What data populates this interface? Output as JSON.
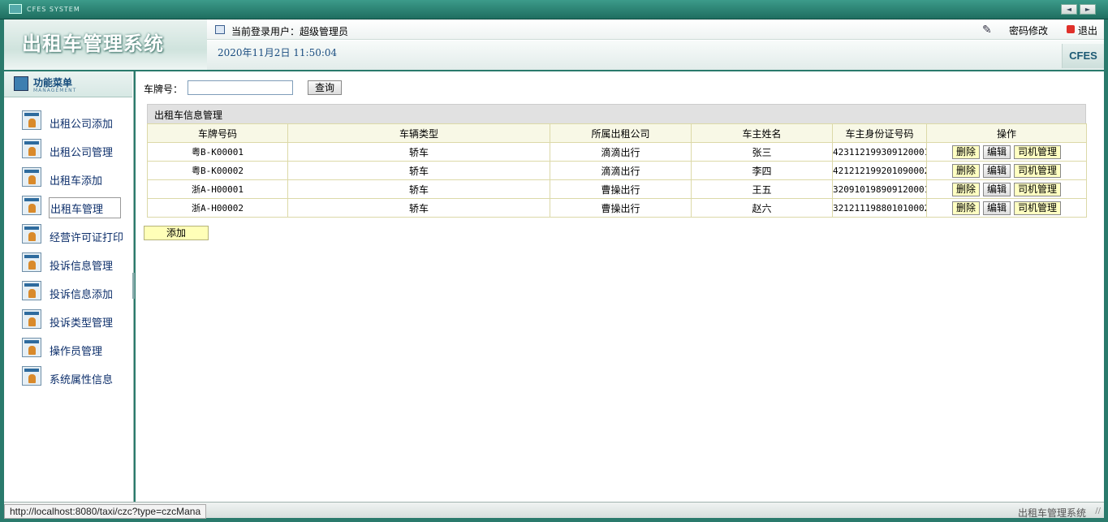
{
  "titlebar": {
    "app_name": "CFES SYSTEM",
    "nav_prev": "◄",
    "nav_next": "►"
  },
  "header": {
    "system_title": "出租车管理系统",
    "user_line": "当前登录用户：超级管理员",
    "change_password": "密码修改",
    "logout": "退出",
    "datetime": "2020年11月2日 11:50:04",
    "brand": "CFES"
  },
  "sidebar": {
    "menu_title": "功能菜单",
    "menu_subtitle": "MANAGEMENT",
    "items": [
      {
        "label": "出租公司添加"
      },
      {
        "label": "出租公司管理"
      },
      {
        "label": "出租车添加"
      },
      {
        "label": "出租车管理"
      },
      {
        "label": "经营许可证打印"
      },
      {
        "label": "投诉信息管理"
      },
      {
        "label": "投诉信息添加"
      },
      {
        "label": "投诉类型管理"
      },
      {
        "label": "操作员管理"
      },
      {
        "label": "系统属性信息"
      }
    ]
  },
  "search": {
    "label": "车牌号：",
    "value": "",
    "button": "查询"
  },
  "panel": {
    "title": "出租车信息管理",
    "columns": [
      "车牌号码",
      "车辆类型",
      "所属出租公司",
      "车主姓名",
      "车主身份证号码",
      "操作"
    ],
    "rows": [
      {
        "plate": "粤B-K00001",
        "type": "轿车",
        "company": "滴滴出行",
        "owner": "张三",
        "id_card": "423112199309120001"
      },
      {
        "plate": "粤B-K00002",
        "type": "轿车",
        "company": "滴滴出行",
        "owner": "李四",
        "id_card": "421212199201090002"
      },
      {
        "plate": "浙A-H00001",
        "type": "轿车",
        "company": "曹操出行",
        "owner": "王五",
        "id_card": "320910198909120001"
      },
      {
        "plate": "浙A-H00002",
        "type": "轿车",
        "company": "曹操出行",
        "owner": "赵六",
        "id_card": "321211198801010002"
      }
    ],
    "actions": {
      "delete": "删除",
      "edit": "编辑",
      "driver": "司机管理"
    },
    "add_button": "添加"
  },
  "statusbar": {
    "url": "http://localhost:8080/taxi/czc?type=czcMana",
    "system_name": "出租车管理系统",
    "grip": "//"
  }
}
